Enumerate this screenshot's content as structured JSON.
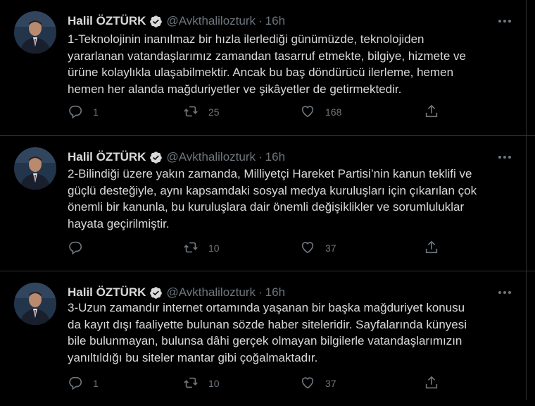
{
  "tweets": [
    {
      "author": "Halil ÖZTÜRK",
      "handle": "@Avkthalilozturk",
      "time": "16h",
      "text": "1-Teknolojinin inanılmaz bir hızla ilerlediği günümüzde, teknolojiden\nyararlanan vatandaşlarımız zamandan tasarruf etmekte, bilgiye, hizmete ve\nürüne kolaylıkla ulaşabilmektir. Ancak bu baş döndürücü ilerleme, hemen\nhemen her alanda mağduriyetler ve şikâyetler de getirmektedir.",
      "replies": "1",
      "retweets": "25",
      "likes": "168"
    },
    {
      "author": "Halil ÖZTÜRK",
      "handle": "@Avkthalilozturk",
      "time": "16h",
      "text": "2-Bilindiği üzere yakın zamanda, Milliyetçi Hareket Partisi’nin kanun teklifi ve\ngüçlü desteğiyle, aynı kapsamdaki sosyal medya kuruluşları için çıkarılan çok\nönemli bir kanunla, bu kuruluşlara dair önemli değişiklikler ve sorumluluklar\nhayata geçirilmiştir.",
      "replies": "",
      "retweets": "10",
      "likes": "37"
    },
    {
      "author": "Halil ÖZTÜRK",
      "handle": "@Avkthalilozturk",
      "time": "16h",
      "text": "3-Uzun zamandır internet ortamında yaşanan bir başka mağduriyet konusu\nda kayıt dışı faaliyette bulunan sözde haber siteleridir. Sayfalarında künyesi\nbile bulunmayan, bulunsa dâhi gerçek olmayan bilgilerle vatandaşlarımızın\nyanıltıldığı bu siteler mantar gibi çoğalmaktadır.",
      "replies": "1",
      "retweets": "10",
      "likes": "37"
    }
  ],
  "separator": "·",
  "colors": {
    "background": "#000000",
    "text": "#d9d9d9",
    "muted": "#6e767d",
    "border": "#2f3336",
    "verified_badge": "#d9d9d9"
  },
  "icons": [
    "avatar-photo",
    "verified-badge-icon",
    "more-icon",
    "reply-icon",
    "retweet-icon",
    "like-icon",
    "share-icon"
  ]
}
